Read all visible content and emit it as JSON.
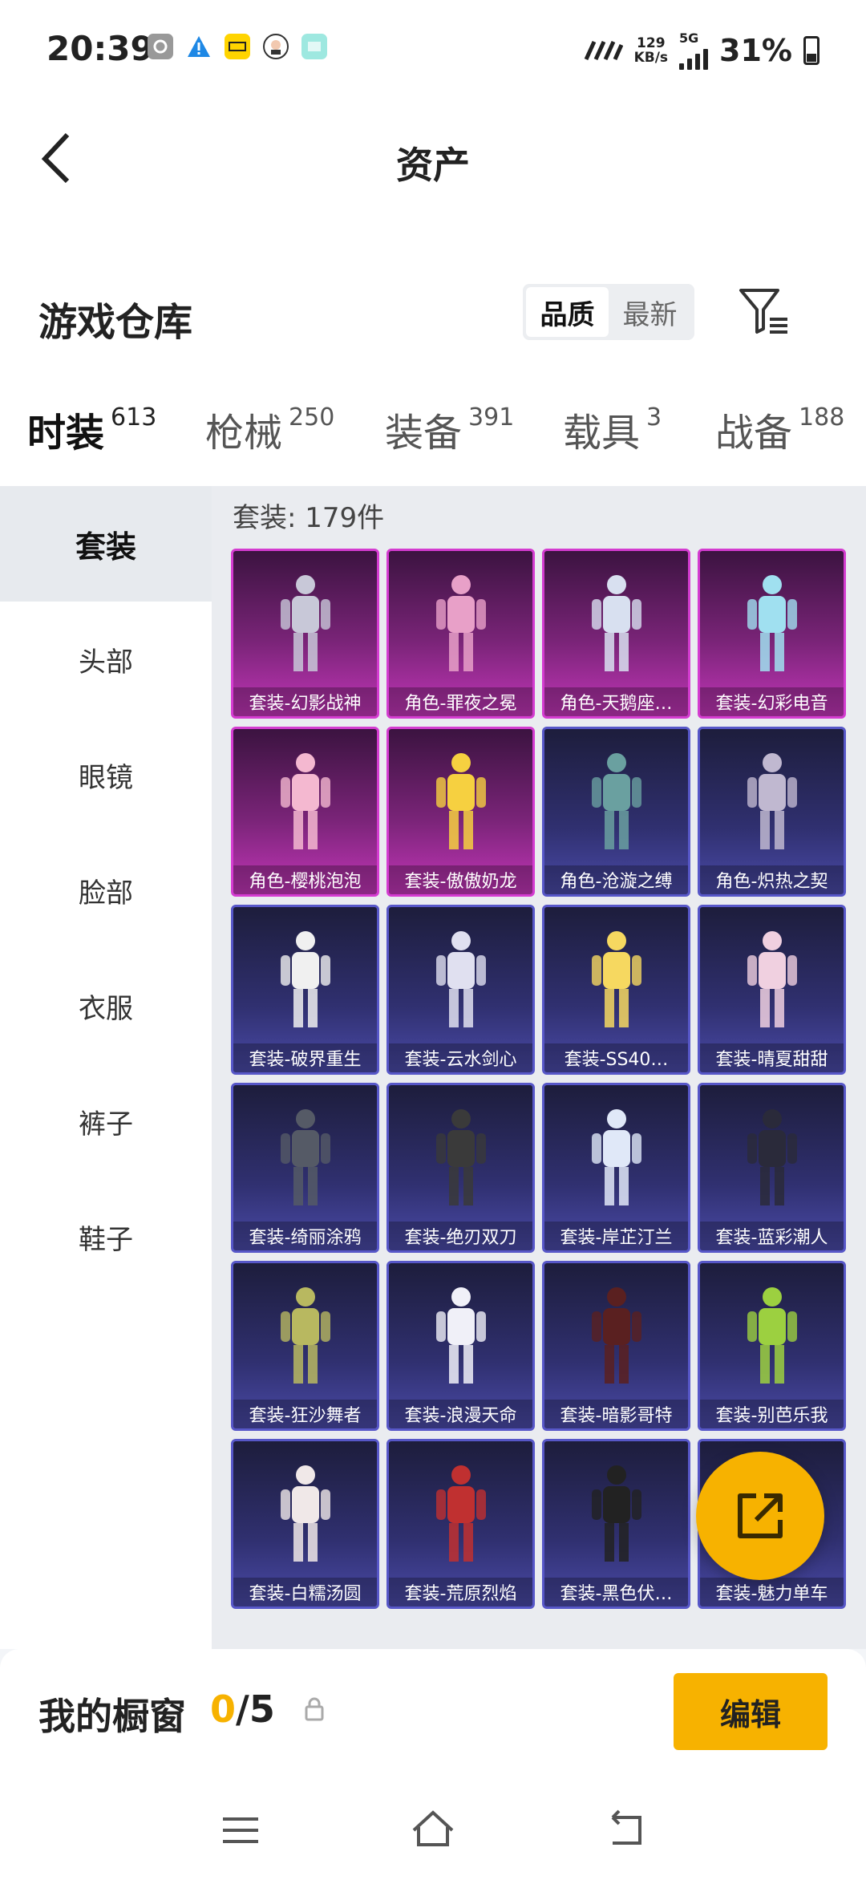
{
  "status_bar": {
    "time": "20:39",
    "net_speed": "129",
    "net_unit": "KB/s",
    "signal": "5G",
    "battery": "31%",
    "left_icons": [
      "settings-icon",
      "alert-icon",
      "app-badge-icon",
      "avatar-icon",
      "app-icon"
    ]
  },
  "nav": {
    "title": "资产"
  },
  "warehouse": {
    "label": "游戏仓库",
    "sort_options": [
      "品质",
      "最新"
    ],
    "sort_selected": "品质"
  },
  "tabs": [
    {
      "label": "时装",
      "count": "613"
    },
    {
      "label": "枪械",
      "count": "250"
    },
    {
      "label": "装备",
      "count": "391"
    },
    {
      "label": "载具",
      "count": "3"
    },
    {
      "label": "战备",
      "count": "188"
    }
  ],
  "sidebar": [
    "套装",
    "头部",
    "眼镜",
    "脸部",
    "衣服",
    "裤子",
    "鞋子"
  ],
  "content": {
    "count_label": "套装: 179件",
    "items": [
      {
        "name": "套装-幻影战神",
        "rarity": "purple"
      },
      {
        "name": "角色-罪夜之冕",
        "rarity": "purple"
      },
      {
        "name": "角色-天鹅座…",
        "rarity": "purple"
      },
      {
        "name": "套装-幻彩电音",
        "rarity": "purple"
      },
      {
        "name": "角色-樱桃泡泡",
        "rarity": "purple"
      },
      {
        "name": "套装-傲傲奶龙",
        "rarity": "purple"
      },
      {
        "name": "角色-沧漩之缚",
        "rarity": "blue"
      },
      {
        "name": "角色-炽热之契",
        "rarity": "blue"
      },
      {
        "name": "套装-破界重生",
        "rarity": "blue"
      },
      {
        "name": "套装-云水剑心",
        "rarity": "blue"
      },
      {
        "name": "套装-SS40…",
        "rarity": "blue"
      },
      {
        "name": "套装-晴夏甜甜",
        "rarity": "blue"
      },
      {
        "name": "套装-绮丽涂鸦",
        "rarity": "blue"
      },
      {
        "name": "套装-绝刃双刀",
        "rarity": "blue"
      },
      {
        "name": "套装-岸芷汀兰",
        "rarity": "blue"
      },
      {
        "name": "套装-蓝彩潮人",
        "rarity": "blue"
      },
      {
        "name": "套装-狂沙舞者",
        "rarity": "blue"
      },
      {
        "name": "套装-浪漫天命",
        "rarity": "blue"
      },
      {
        "name": "套装-暗影哥特",
        "rarity": "blue"
      },
      {
        "name": "套装-别芭乐我",
        "rarity": "blue"
      },
      {
        "name": "套装-白糯汤圆",
        "rarity": "blue"
      },
      {
        "name": "套装-荒原烈焰",
        "rarity": "blue"
      },
      {
        "name": "套装-黑色伏…",
        "rarity": "blue"
      },
      {
        "name": "套装-魅力单车",
        "rarity": "blue"
      }
    ]
  },
  "bottom": {
    "label": "我的橱窗",
    "used": "0",
    "total": "/5",
    "edit_label": "编辑"
  },
  "colors": {
    "accent": "#f7b200",
    "purple": "#c236b8",
    "blue": "#4a4aa8"
  }
}
